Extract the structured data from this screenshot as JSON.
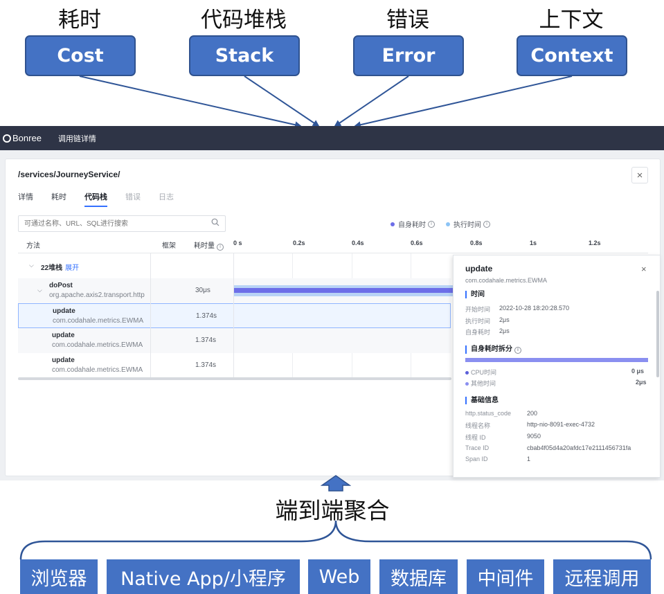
{
  "concepts": [
    {
      "caption": "耗时",
      "label": "Cost"
    },
    {
      "caption": "代码堆栈",
      "label": "Stack"
    },
    {
      "caption": "错误",
      "label": "Error"
    },
    {
      "caption": "上下文",
      "label": "Context"
    }
  ],
  "app": {
    "logo_text": "Bonree",
    "page_title": "调用链详情"
  },
  "trace": {
    "title": "/services/JourneyService/",
    "close_glyph": "×",
    "tabs": [
      "详情",
      "耗时",
      "代码栈",
      "错误",
      "日志"
    ],
    "active_tab": 2,
    "search_placeholder": "可通过名称、URL、SQL进行搜索",
    "legend": {
      "self_time": "自身耗时",
      "exec_time": "执行时间"
    },
    "columns": {
      "method": "方法",
      "framework": "框架",
      "self": "耗时量"
    },
    "ticks": [
      "0 s",
      "0.2s",
      "0.4s",
      "0.6s",
      "0.8s",
      "1s",
      "1.2s"
    ],
    "group": {
      "label": "22堆栈",
      "action": "展开"
    },
    "rows": [
      {
        "name": "doPost",
        "class": "org.apache.axis2.transport.http",
        "duration": "30μs"
      },
      {
        "name": "update",
        "class": "com.codahale.metrics.EWMA",
        "duration": "1.374s"
      },
      {
        "name": "update",
        "class": "com.codahale.metrics.EWMA",
        "duration": "1.374s"
      },
      {
        "name": "update",
        "class": "com.codahale.metrics.EWMA",
        "duration": "1.374s"
      }
    ]
  },
  "detail": {
    "title": "update",
    "subtitle": "com.codahale.metrics.EWMA",
    "close_glyph": "×",
    "time_section": "时间",
    "time_fields": [
      {
        "key": "开始时间",
        "value": "2022-10-28 18:20:28.570"
      },
      {
        "key": "执行时间",
        "value": "2μs"
      },
      {
        "key": "自身耗时",
        "value": "2μs"
      }
    ],
    "split_section": "自身耗时拆分",
    "split": [
      {
        "key": "CPU时间",
        "value": "0 μs",
        "share": 0.0,
        "color": "#5b5fd9"
      },
      {
        "key": "其他时间",
        "value": "2μs",
        "share": 1.0,
        "color": "#8a8ff0"
      }
    ],
    "info_section": "基础信息",
    "info_fields": [
      {
        "key": "http.status_code",
        "value": "200"
      },
      {
        "key": "线程名称",
        "value": "http-nio-8091-exec-4732"
      },
      {
        "key": "线程 ID",
        "value": "9050"
      },
      {
        "key": "Trace ID",
        "value": "cbab4f05d4a20afdc17e2111456731fa"
      },
      {
        "key": "Span ID",
        "value": "1"
      }
    ]
  },
  "aggregate_label": "端到端聚合",
  "sources": [
    "浏览器",
    "Native App/小程序",
    "Web",
    "数据库",
    "中间件",
    "远程调用"
  ],
  "colors": {
    "accent": "#4472c4",
    "appbar": "#2e3446",
    "link": "#3370ff",
    "arrow": "#2f5597"
  }
}
